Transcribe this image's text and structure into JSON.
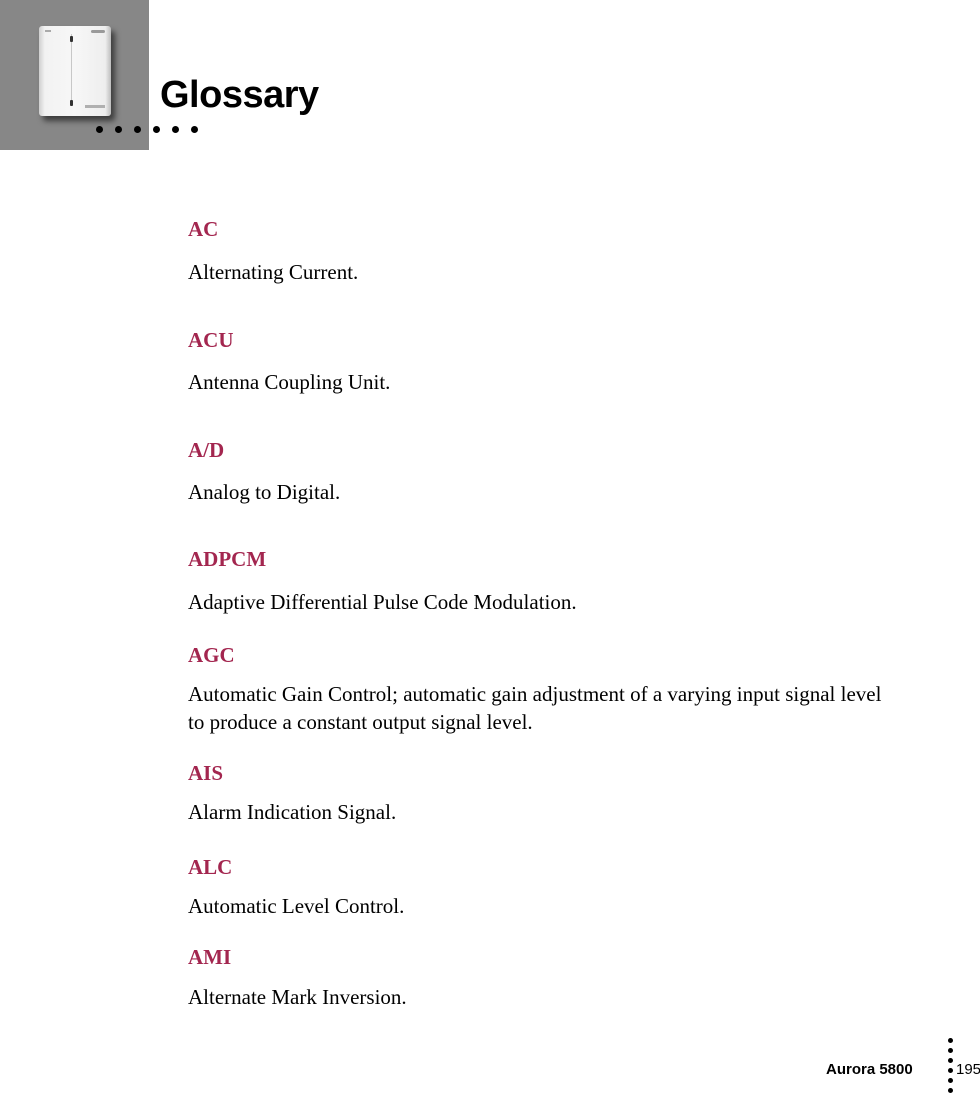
{
  "header": {
    "title": "Glossary",
    "image": "device-photo-icon"
  },
  "entries": [
    {
      "term": "AC",
      "definition": "Alternating Current."
    },
    {
      "term": "ACU",
      "definition": "Antenna Coupling Unit."
    },
    {
      "term": "A/D",
      "definition": "Analog to Digital."
    },
    {
      "term": "ADPCM",
      "definition": "Adaptive Differential Pulse Code Modulation."
    },
    {
      "term": "AGC",
      "definition": "Automatic Gain Control; automatic gain adjustment of a varying input signal level to produce a constant output signal level."
    },
    {
      "term": "AIS",
      "definition": "Alarm Indication Signal."
    },
    {
      "term": "ALC",
      "definition": "Automatic Level Control."
    },
    {
      "term": "AMI",
      "definition": "Alternate Mark Inversion."
    }
  ],
  "footer": {
    "product": "Aurora 5800",
    "page": "195"
  },
  "colors": {
    "term": "#a3264f",
    "header_block": "#878787"
  }
}
